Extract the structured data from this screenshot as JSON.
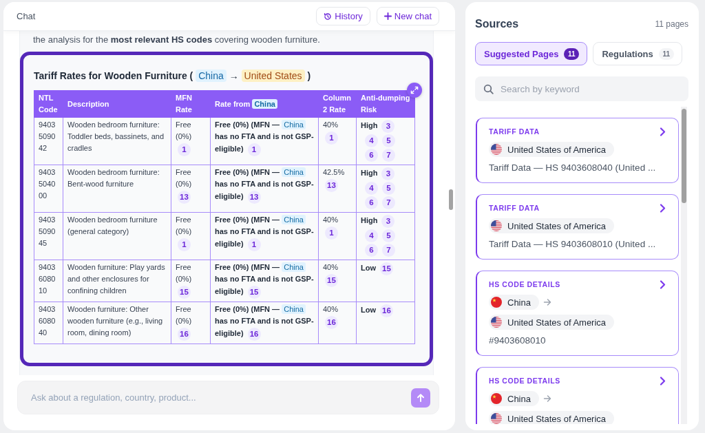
{
  "chat": {
    "title": "Chat",
    "actions": [
      {
        "kind": "history",
        "label": "History"
      },
      {
        "kind": "new",
        "label": "New chat"
      }
    ],
    "message_text": "the analysis for the **most relevant HS codes** covering wooden furniture.",
    "tariff_table": {
      "title": {
        "before": "Tariff Rates for Wooden Furniture (",
        "origin": "China",
        "arrow": "→",
        "destination": "United States",
        "after": ")"
      },
      "columns": [
        {
          "label": "NTL Code"
        },
        {
          "label": "Description"
        },
        {
          "label": "MFN Rate"
        },
        {
          "label": "Rate from",
          "chip": "China"
        },
        {
          "label": "Column 2 Rate"
        },
        {
          "label": "Anti-dumping Risk"
        }
      ],
      "rows": [
        {
          "code": "9403 5090 42",
          "description": "Wooden bedroom furniture: Toddler beds, bassinets, and cradles",
          "mfn_rate": {
            "text": "Free (0%)",
            "refs": [
              "1"
            ]
          },
          "rate_from_origin": {
            "before": "Free (0%) (MFN —",
            "chip": "China",
            "after": "has no FTA and is not GSP-eligible)",
            "refs": [
              "1"
            ]
          },
          "column_2_rate": {
            "text": "40%",
            "refs": [
              "1"
            ]
          },
          "risk": {
            "text": "High",
            "refs": [
              "3",
              "4",
              "5",
              "6",
              "7"
            ]
          }
        },
        {
          "code": "9403 5040 00",
          "description": "Wooden bedroom furniture: Bent-wood furniture",
          "mfn_rate": {
            "text": "Free (0%)",
            "refs": [
              "13"
            ]
          },
          "rate_from_origin": {
            "before": "Free (0%) (MFN —",
            "chip": "China",
            "after": "has no FTA and is not GSP-eligible)",
            "refs": [
              "13"
            ]
          },
          "column_2_rate": {
            "text": "42.5%",
            "refs": [
              "13"
            ]
          },
          "risk": {
            "text": "High",
            "refs": [
              "3",
              "4",
              "5",
              "6",
              "7"
            ]
          }
        },
        {
          "code": "9403 5090 45",
          "description": "Wooden bedroom furniture (general category)",
          "mfn_rate": {
            "text": "Free (0%)",
            "refs": [
              "1"
            ]
          },
          "rate_from_origin": {
            "before": "Free (0%) (MFN —",
            "chip": "China",
            "after": "has no FTA and is not GSP-eligible)",
            "refs": [
              "1"
            ]
          },
          "column_2_rate": {
            "text": "40%",
            "refs": [
              "1"
            ]
          },
          "risk": {
            "text": "High",
            "refs": [
              "3",
              "4",
              "5",
              "6",
              "7"
            ]
          }
        },
        {
          "code": "9403 6080 10",
          "description": "Wooden furniture: Play yards and other enclosures for confining children",
          "mfn_rate": {
            "text": "Free (0%)",
            "refs": [
              "15"
            ]
          },
          "rate_from_origin": {
            "before": "Free (0%) (MFN —",
            "chip": "China",
            "after": "has no FTA and is not GSP-eligible)",
            "refs": [
              "15"
            ]
          },
          "column_2_rate": {
            "text": "40%",
            "refs": [
              "15"
            ]
          },
          "risk": {
            "text": "Low",
            "refs": [
              "15"
            ]
          }
        },
        {
          "code": "9403 6080 40",
          "description": "Wooden furniture: Other wooden furniture (e.g., living room, dining room)",
          "mfn_rate": {
            "text": "Free (0%)",
            "refs": [
              "16"
            ]
          },
          "rate_from_origin": {
            "before": "Free (0%) (MFN —",
            "chip": "China",
            "after": "has no FTA and is not GSP-eligible)",
            "refs": [
              "16"
            ]
          },
          "column_2_rate": {
            "text": "40%",
            "refs": [
              "16"
            ]
          },
          "risk": {
            "text": "Low",
            "refs": [
              "16"
            ]
          }
        }
      ]
    },
    "composer": {
      "placeholder": "Ask about a regulation, country, product...",
      "send_disabled": true
    }
  },
  "sources": {
    "title": "Sources",
    "count": "11 pages",
    "tabs": [
      {
        "label": "Suggested Pages",
        "count": "11",
        "selected": true
      },
      {
        "label": "Regulations",
        "count": "11",
        "selected": false
      }
    ],
    "search": {
      "placeholder": "Search by keyword"
    },
    "cards": [
      {
        "category": "TARIFF DATA",
        "countries": [
          {
            "kind": "usa",
            "name": "United States of America"
          }
        ],
        "text": "Tariff Data — HS 9403608040 (United ..."
      },
      {
        "category": "TARIFF DATA",
        "countries": [
          {
            "kind": "usa",
            "name": "United States of America"
          }
        ],
        "text": "Tariff Data — HS 9403608010 (United ..."
      },
      {
        "category": "HS CODE DETAILS",
        "countries": [
          {
            "kind": "china",
            "name": "China"
          },
          {
            "kind": "usa",
            "name": "United States of America"
          }
        ],
        "text": "#9403608010"
      },
      {
        "category": "HS CODE DETAILS",
        "countries": [
          {
            "kind": "china",
            "name": "China"
          },
          {
            "kind": "usa",
            "name": "United States of America"
          }
        ]
      }
    ]
  }
}
